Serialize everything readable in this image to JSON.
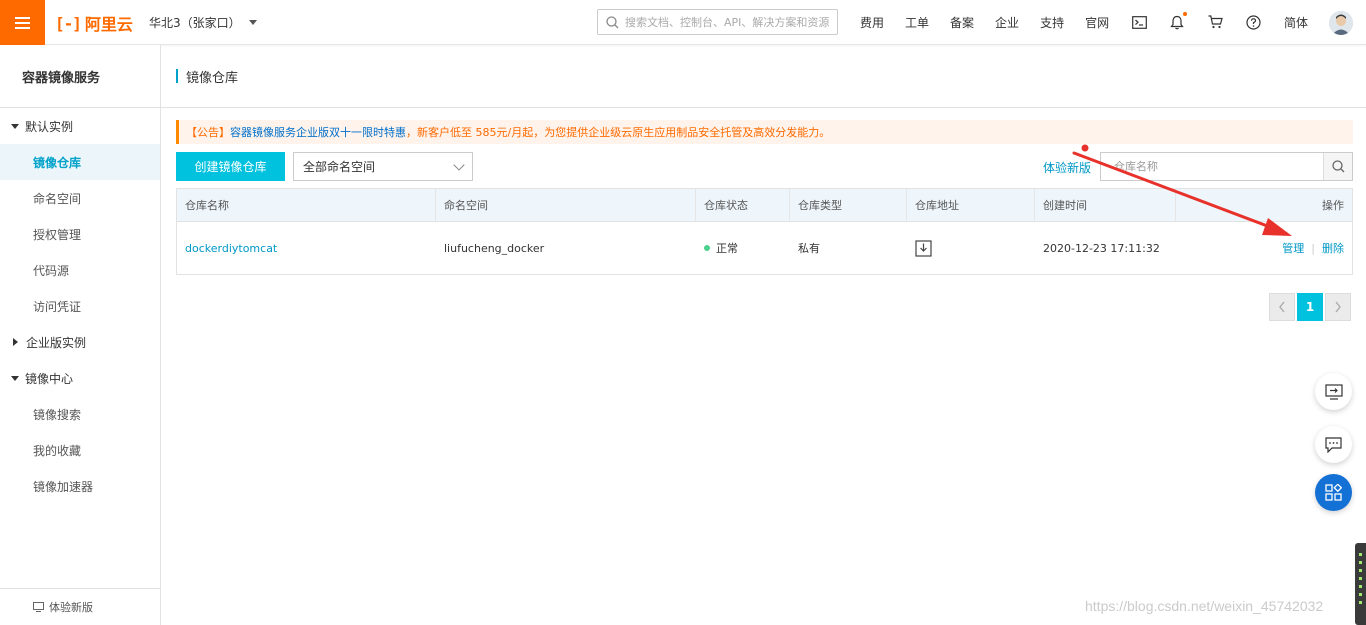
{
  "topbar": {
    "logo_text": "阿里云",
    "region": "华北3（张家口）",
    "search_placeholder": "搜索文档、控制台、API、解决方案和资源",
    "nav": [
      "费用",
      "工单",
      "备案",
      "企业",
      "支持",
      "官网"
    ],
    "lang": "简体",
    "icons": [
      "terminal-icon",
      "bell-icon",
      "cart-icon",
      "help-icon"
    ]
  },
  "sidebar": {
    "title": "容器镜像服务",
    "groups": [
      {
        "label": "默认实例",
        "expanded": true,
        "items": [
          "镜像仓库",
          "命名空间",
          "授权管理",
          "代码源",
          "访问凭证"
        ]
      },
      {
        "label": "企业版实例",
        "expanded": false,
        "items": []
      },
      {
        "label": "镜像中心",
        "expanded": true,
        "items": [
          "镜像搜索",
          "我的收藏",
          "镜像加速器"
        ]
      }
    ],
    "active_item": "镜像仓库",
    "footer": "体验新版"
  },
  "main": {
    "title": "镜像仓库",
    "notice": {
      "prefix": "【公告】",
      "link": "容器镜像服务企业版双十一限时特惠",
      "text": "，新客户低至 585元/月起，为您提供企业级云原生应用制品安全托管及高效分发能力。"
    },
    "create_button": "创建镜像仓库",
    "namespace_select": "全部命名空间",
    "try_new": "体验新版",
    "repo_search_placeholder": "仓库名称",
    "table": {
      "headers": [
        "仓库名称",
        "命名空间",
        "仓库状态",
        "仓库类型",
        "仓库地址",
        "创建时间",
        "操作"
      ],
      "rows": [
        {
          "name": "dockerdiytomcat",
          "namespace": "liufucheng_docker",
          "status": "正常",
          "type": "私有",
          "created": "2020-12-23 17:11:32",
          "actions": [
            "管理",
            "删除"
          ]
        }
      ]
    },
    "pagination": {
      "current": "1"
    }
  },
  "watermark": "https://blog.csdn.net/weixin_45742032",
  "colors": {
    "brand": "#ff6a00",
    "accent": "#00c1de",
    "link": "#0098c6",
    "status_ok": "#4cd08d",
    "annotation": "#e8312a"
  }
}
